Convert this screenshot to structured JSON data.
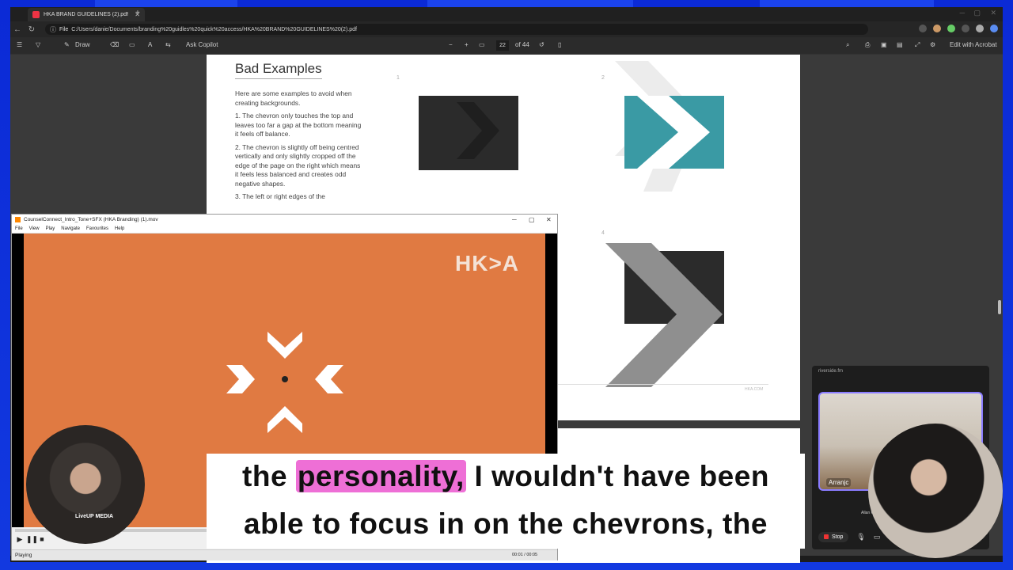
{
  "browser": {
    "tab_title": "HKA BRAND GUIDELINES (2).pdf",
    "url_label": "File",
    "url": "C:/Users/danie/Documents/branding%20guidles%20quick%20access/HKA%20BRAND%20GUIDELINES%20(2).pdf"
  },
  "pdf_toolbar": {
    "draw_label": "Draw",
    "copilot_label": "Ask Copilot",
    "page_number": "22",
    "page_total": "of 44",
    "edit_label": "Edit with Acrobat"
  },
  "pdf_page": {
    "heading": "Bad Examples",
    "intro": "Here are some examples to avoid when creating backgrounds.",
    "point1": "1. The chevron only touches the top and leaves too far a gap at the bottom meaning it feels off balance.",
    "point2": "2. The chevron is slightly off being centred vertically and only slightly cropped off the edge of the page on the right which means it feels less balanced and creates odd negative shapes.",
    "point3": "3. The left or right edges of the",
    "num1": "1",
    "num2": "2",
    "num4": "4",
    "footer_url": "HKA.COM"
  },
  "player": {
    "title": "CounselConnect_Intro_Tone+SFX (HKA Branding) (1).mov",
    "menu": [
      "File",
      "View",
      "Play",
      "Navigate",
      "Favourites",
      "Help"
    ],
    "logo": "HK>A",
    "status": "Playing",
    "time": "00:01 / 00:05"
  },
  "riverside": {
    "header": "riverside.fm",
    "name_tag": "Arranjc",
    "small_label": "Allan R.",
    "stop_label": "Stop"
  },
  "webcam": {
    "left_logo": "LiveUP MEDIA"
  },
  "caption": {
    "line1_pre": "the ",
    "line1_highlight": "personality,",
    "line1_post": " I wouldn't have been",
    "line2": "able to focus in on the chevrons, the"
  },
  "colors": {
    "frame_blue": "#1239e0",
    "video_orange": "#e07a42",
    "teal": "#3a9aa4",
    "charcoal": "#2b2b2b",
    "highlight_pink": "#ee6fd6",
    "riverside_accent": "#8a7cff"
  }
}
